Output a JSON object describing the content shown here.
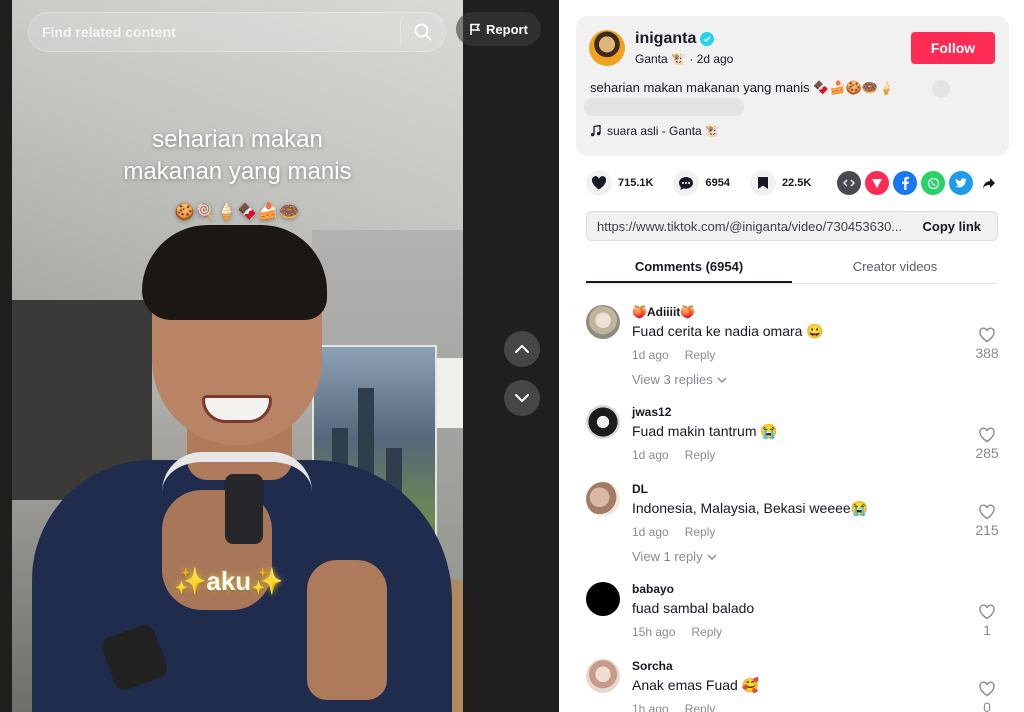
{
  "video": {
    "search_placeholder": "Find related content",
    "report_label": "Report",
    "caption_line1": "seharian makan",
    "caption_line2": "makanan yang manis",
    "emoji_line": "🍪🍭🍦🍫🍰🍩",
    "overlay_word": "✨aku✨"
  },
  "post": {
    "author": "iniganta",
    "author_display": "Ganta 🐮",
    "posted": "2d ago",
    "follow_label": "Follow",
    "description": "seharian makan makanan yang manis 🍫🍰🍪🍩🍦",
    "music": "suara asli - Ganta 🐮"
  },
  "stats": {
    "likes": "715.1K",
    "comments": "6954",
    "saves": "22.5K"
  },
  "share": {
    "link_url": "https://www.tiktok.com/@iniganta/video/730453630...",
    "copy_label": "Copy link"
  },
  "tabs": {
    "comments": "Comments (6954)",
    "creator": "Creator videos"
  },
  "comments": [
    {
      "user": "🍑Adiiiit🍑",
      "text": "Fuad cerita ke nadia omara 😀",
      "time": "1d ago",
      "reply": "Reply",
      "likes": "388",
      "view_replies": "View 3 replies"
    },
    {
      "user": "jwas12",
      "text": "Fuad makin tantrum 😭",
      "time": "1d ago",
      "reply": "Reply",
      "likes": "285",
      "view_replies": ""
    },
    {
      "user": "DL",
      "text": "Indonesia, Malaysia, Bekasi weeee😭",
      "time": "1d ago",
      "reply": "Reply",
      "likes": "215",
      "view_replies": "View 1 reply"
    },
    {
      "user": "babayo",
      "text": "fuad sambal balado",
      "time": "15h ago",
      "reply": "Reply",
      "likes": "1",
      "view_replies": ""
    },
    {
      "user": "Sorcha",
      "text": "Anak emas Fuad 🥰",
      "time": "1h ago",
      "reply": "Reply",
      "likes": "0",
      "view_replies": ""
    }
  ],
  "colors": {
    "accent": "#fe2c55",
    "verified": "#20d5ec",
    "muted": "#8a8b91"
  }
}
